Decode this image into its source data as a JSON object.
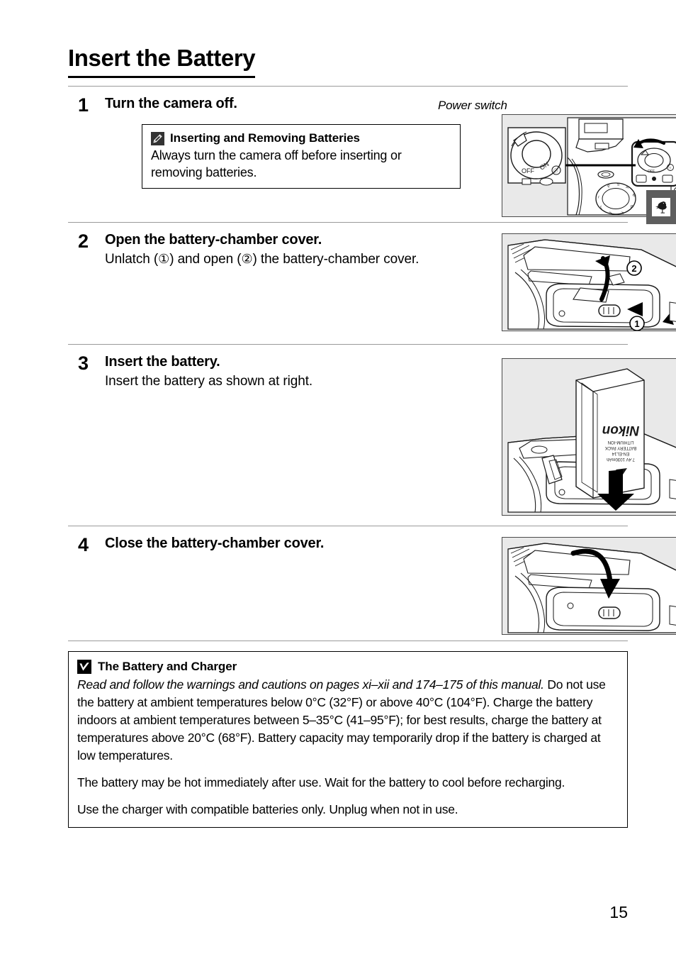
{
  "document": {
    "title": "Insert the Battery",
    "page_number": "15",
    "side_tab_icon": "rooster-icon"
  },
  "steps": [
    {
      "number": "1",
      "heading": "Turn the camera off.",
      "text": "",
      "illustration_caption": "Power switch",
      "illustration_labels": {
        "off": "OFF",
        "on": "ON"
      }
    },
    {
      "number": "2",
      "heading": "Open the battery-chamber cover.",
      "text_before_1": "Unlatch (",
      "marker_1": "①",
      "text_mid": ") and open (",
      "marker_2": "②",
      "text_after": ") the battery-chamber cover."
    },
    {
      "number": "3",
      "heading": "Insert the battery.",
      "text": "Insert the battery as shown at right.",
      "battery_label_brand": "Nikon",
      "battery_label_line1": "LITHIUM-ION",
      "battery_label_line2": "BATTERY PACK",
      "battery_label_line3": "EN-EL14",
      "battery_label_line4": "7.4V 1030mAh"
    },
    {
      "number": "4",
      "heading": "Close the battery-chamber cover.",
      "text": ""
    }
  ],
  "note_box": {
    "icon": "pencil-icon",
    "heading": "Inserting and Removing Batteries",
    "body": "Always turn the camera off before inserting or removing batteries."
  },
  "warning_box": {
    "icon": "caution-check-icon",
    "heading": "The Battery and Charger",
    "paragraph_1_italic": "Read and follow the warnings and cautions on pages xi–xii and 174–175 of this manual.",
    "paragraph_1_rest": "  Do not use the battery at ambient temperatures below 0°C (32°F) or above 40°C (104°F).  Charge the battery indoors at ambient temperatures between 5–35°C (41–95°F); for best results, charge the battery at temperatures above 20°C (68°F).  Battery capacity may temporarily drop if the battery is charged at low temperatures.",
    "paragraph_2": "The battery may be hot immediately after use.  Wait for the battery to cool before recharging.",
    "paragraph_3": "Use the charger with compatible batteries only.  Unplug when not in use."
  },
  "colors": {
    "illustration_background": "#e9e9e9",
    "rule": "#9a9a9a",
    "side_tab": "#5e5e5e",
    "text": "#000000"
  }
}
